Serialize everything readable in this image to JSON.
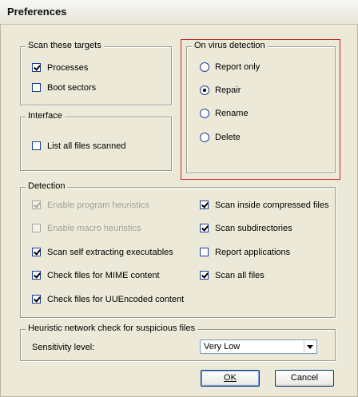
{
  "window": {
    "title": "Preferences"
  },
  "scan_targets": {
    "legend": "Scan these targets",
    "items": [
      {
        "label": "Processes",
        "checked": true
      },
      {
        "label": "Boot sectors",
        "checked": false
      }
    ]
  },
  "interface": {
    "legend": "Interface",
    "items": [
      {
        "label": "List all files scanned",
        "checked": false
      }
    ]
  },
  "virus_detection": {
    "legend": "On virus detection",
    "options": [
      "Report only",
      "Repair",
      "Rename",
      "Delete"
    ],
    "selected": "Repair"
  },
  "detection": {
    "legend": "Detection",
    "left": [
      {
        "label": "Enable program heuristics",
        "checked": true,
        "disabled": true
      },
      {
        "label": "Enable macro heuristics",
        "checked": false,
        "disabled": true
      },
      {
        "label": "Scan self extracting executables",
        "checked": true,
        "disabled": false
      },
      {
        "label": "Check files for MIME content",
        "checked": true,
        "disabled": false
      },
      {
        "label": "Check files for UUEncoded content",
        "checked": true,
        "disabled": false
      }
    ],
    "right": [
      {
        "label": "Scan inside compressed files",
        "checked": true
      },
      {
        "label": "Scan subdirectories",
        "checked": true
      },
      {
        "label": "Report applications",
        "checked": false
      },
      {
        "label": "Scan all files",
        "checked": true
      }
    ]
  },
  "heuristic": {
    "legend": "Heuristic network check for suspicious files",
    "sensitivity_label": "Sensitivity level:",
    "sensitivity_value": "Very Low"
  },
  "buttons": {
    "ok": "OK",
    "cancel": "Cancel"
  }
}
